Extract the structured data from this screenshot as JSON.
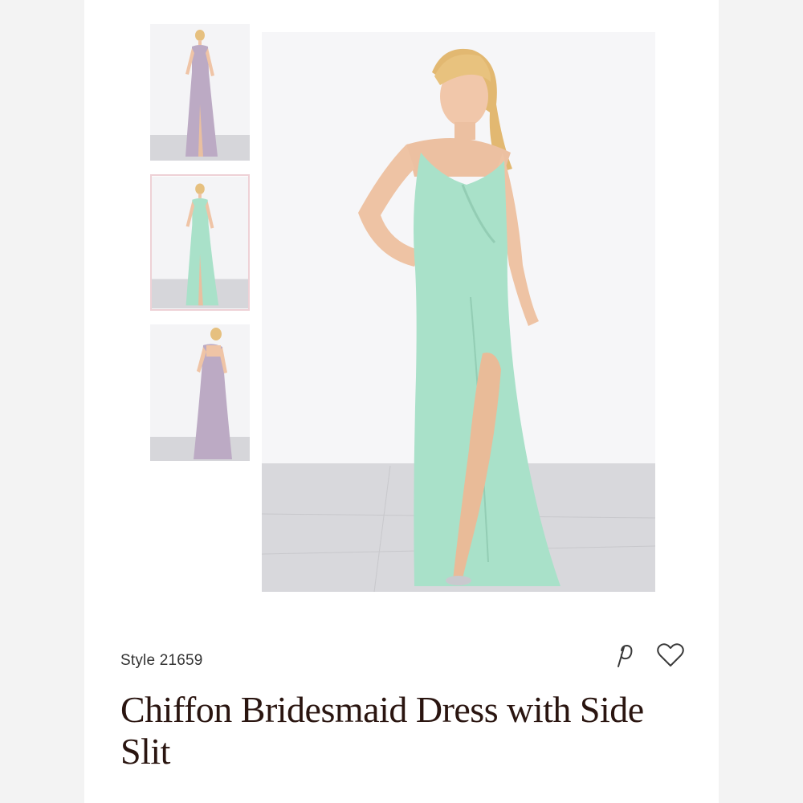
{
  "product": {
    "style_label": "Style 21659",
    "title": "Chiffon Bridesmaid Dress with Side Slit"
  },
  "gallery": {
    "thumbnails": [
      {
        "label": "front view lilac dress",
        "dress_color": "#bcaac4",
        "selected": false
      },
      {
        "label": "front view mint dress",
        "dress_color": "#a9e1c9",
        "selected": true
      },
      {
        "label": "back view lilac dress",
        "dress_color": "#bcaac4",
        "selected": false
      }
    ],
    "main_image": {
      "label": "mint chiffon bridesmaid dress",
      "dress_color": "#a9e1c9"
    }
  },
  "actions": {
    "pinterest_icon": "pinterest-icon",
    "heart_icon": "heart-icon"
  },
  "colors": {
    "title_text": "#2a1510",
    "selected_border": "#eed1d6"
  }
}
